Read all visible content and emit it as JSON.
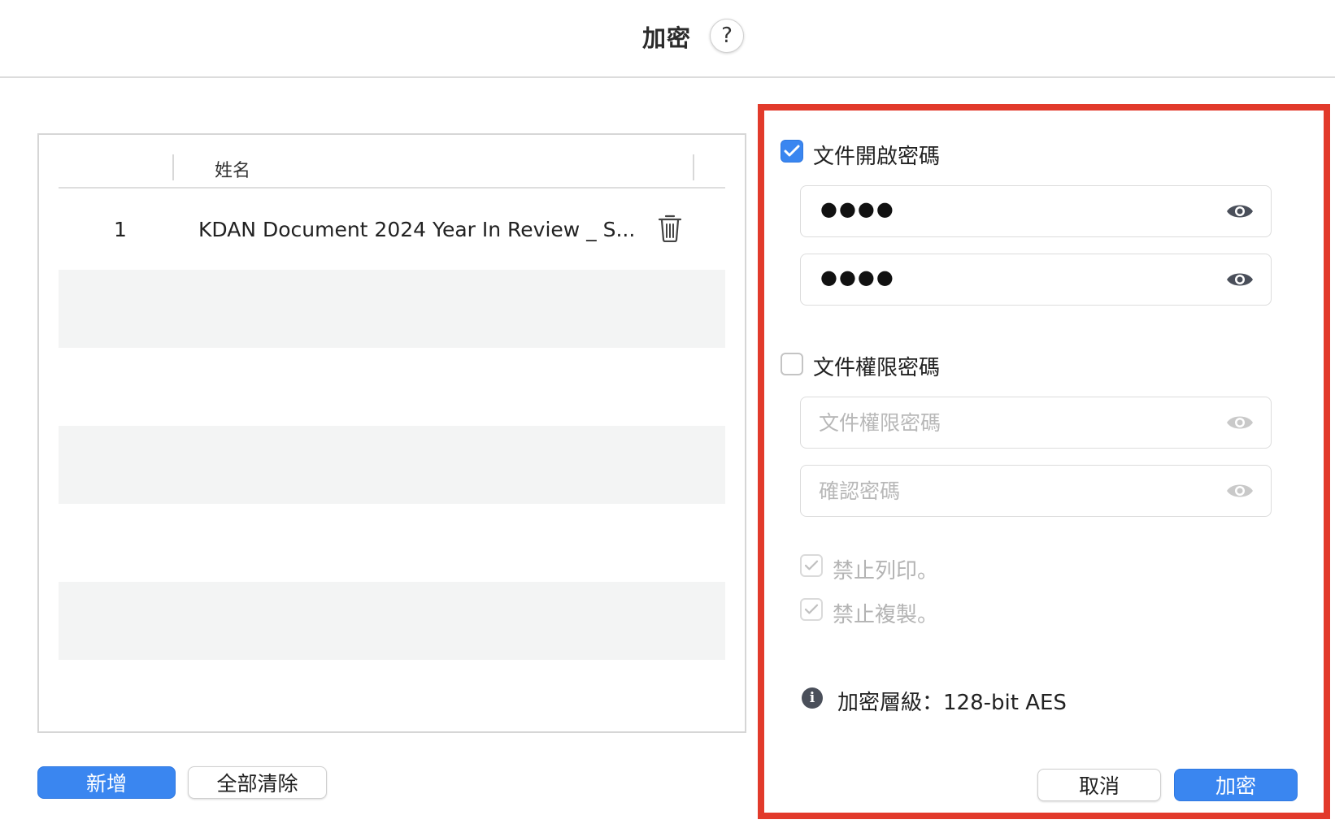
{
  "window": {
    "title": "加密",
    "help_label": "?"
  },
  "file_list": {
    "column_header": "姓名",
    "rows": [
      {
        "index": "1",
        "name": "KDAN Document 2024 Year In Review _ S..."
      }
    ]
  },
  "buttons": {
    "add": "新增",
    "clear_all": "全部清除",
    "cancel": "取消",
    "encrypt": "加密"
  },
  "open_password": {
    "label": "文件開啟密碼",
    "checked": true,
    "password_masked": "●●●●",
    "confirm_masked": "●●●●"
  },
  "permission_password": {
    "label": "文件權限密碼",
    "checked": false,
    "password_placeholder": "文件權限密碼",
    "confirm_placeholder": "確認密碼"
  },
  "restrictions": [
    {
      "label": "禁止列印。",
      "checked": true,
      "disabled": true
    },
    {
      "label": "禁止複製。",
      "checked": true,
      "disabled": true
    }
  ],
  "encryption_level": "加密層級：128-bit AES",
  "colors": {
    "accent": "#3a86f0",
    "highlight_border": "#e23a2b"
  }
}
